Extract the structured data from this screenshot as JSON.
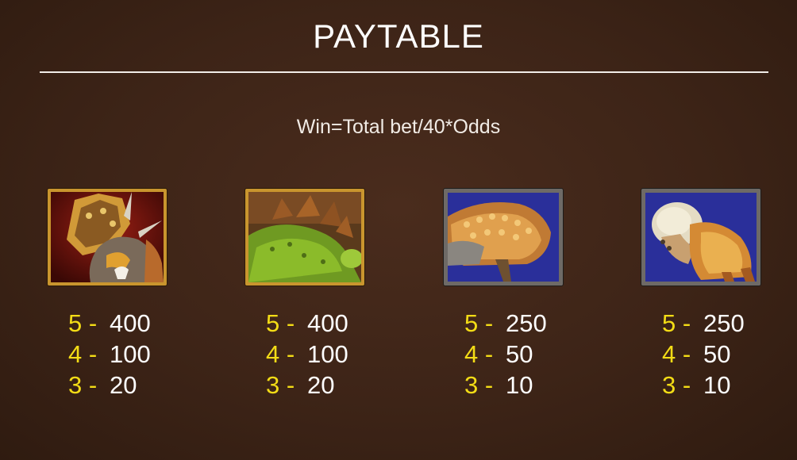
{
  "header": {
    "title": "PAYTABLE"
  },
  "formula": "Win=Total bet/40*Odds",
  "symbols": [
    {
      "icon": "triceratops-icon",
      "pays": [
        {
          "count": "5 -",
          "value": "400"
        },
        {
          "count": "4 -",
          "value": "100"
        },
        {
          "count": "3 -",
          "value": "20"
        }
      ]
    },
    {
      "icon": "stegosaurus-icon",
      "pays": [
        {
          "count": "5 -",
          "value": "400"
        },
        {
          "count": "4 -",
          "value": "100"
        },
        {
          "count": "3 -",
          "value": "20"
        }
      ]
    },
    {
      "icon": "ankylosaurus-icon",
      "pays": [
        {
          "count": "5 -",
          "value": "250"
        },
        {
          "count": "4 -",
          "value": "50"
        },
        {
          "count": "3 -",
          "value": "10"
        }
      ]
    },
    {
      "icon": "pachycephalosaurus-icon",
      "pays": [
        {
          "count": "5 -",
          "value": "250"
        },
        {
          "count": "4 -",
          "value": "50"
        },
        {
          "count": "3 -",
          "value": "10"
        }
      ]
    }
  ],
  "colors": {
    "background": "#3d2417",
    "count_yellow": "#f3dc16",
    "value_white": "#ffffff",
    "gold_frame": "#c9952e",
    "stone_frame": "#6e6a66"
  }
}
